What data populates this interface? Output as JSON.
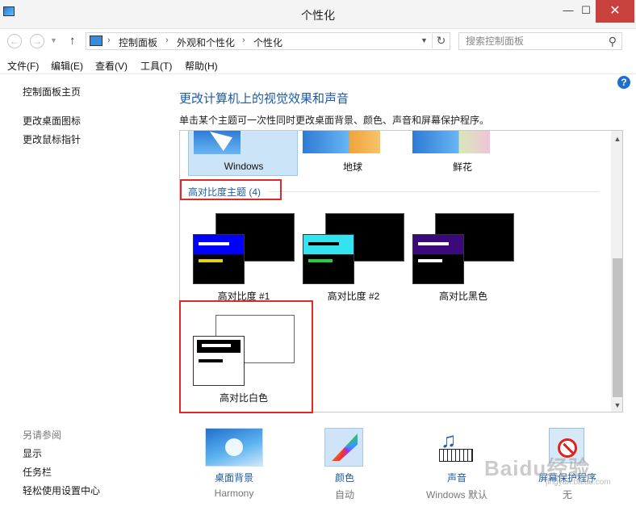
{
  "window": {
    "title": "个性化",
    "min": "—",
    "max": "☐",
    "close": "✕"
  },
  "nav": {
    "back": "←",
    "forward": "→",
    "up": "↑",
    "breadcrumb": [
      "控制面板",
      "外观和个性化",
      "个性化"
    ],
    "separator": "›",
    "search_placeholder": "搜索控制面板"
  },
  "menu": [
    "文件(F)",
    "编辑(E)",
    "查看(V)",
    "工具(T)",
    "帮助(H)"
  ],
  "help": "?",
  "sidebar": {
    "home": "控制面板主页",
    "links": [
      "更改桌面图标",
      "更改鼠标指针"
    ],
    "see_also_heading": "另请参阅",
    "see_also": [
      "显示",
      "任务栏",
      "轻松使用设置中心"
    ]
  },
  "main": {
    "title": "更改计算机上的视觉效果和声音",
    "description": "单击某个主题可一次性同时更改桌面背景、颜色、声音和屏幕保护程序。"
  },
  "themes_top": [
    "Windows",
    "地球",
    "鲜花"
  ],
  "high_contrast": {
    "heading": "高对比度主题 (4)",
    "themes": [
      {
        "name": "高对比度 #1",
        "banner": "#0000ff",
        "bar1": "#ffffff",
        "bar2": "#e6d20a"
      },
      {
        "name": "高对比度 #2",
        "banner": "#33e3f0",
        "bar1": "#000000",
        "bar2": "#20d040"
      },
      {
        "name": "高对比黑色",
        "banner": "#3b0a7a",
        "bar1": "#ffffff",
        "bar2": "#ffffff"
      },
      {
        "name": "高对比白色",
        "banner": "#000000",
        "bar1": "#ffffff",
        "bar2": "#000000"
      }
    ]
  },
  "bottom": [
    {
      "label": "桌面背景",
      "value": "Harmony"
    },
    {
      "label": "颜色",
      "value": "自动"
    },
    {
      "label": "声音",
      "value": "Windows 默认"
    },
    {
      "label": "屏幕保护程序",
      "value": "无"
    }
  ],
  "watermark": {
    "text": "Baidu经验",
    "sub": "jingyan.baidu.com"
  },
  "colors": {
    "accent": "#1d5aa5",
    "highlight": "#e02a28",
    "selection": "#cce4f7"
  }
}
